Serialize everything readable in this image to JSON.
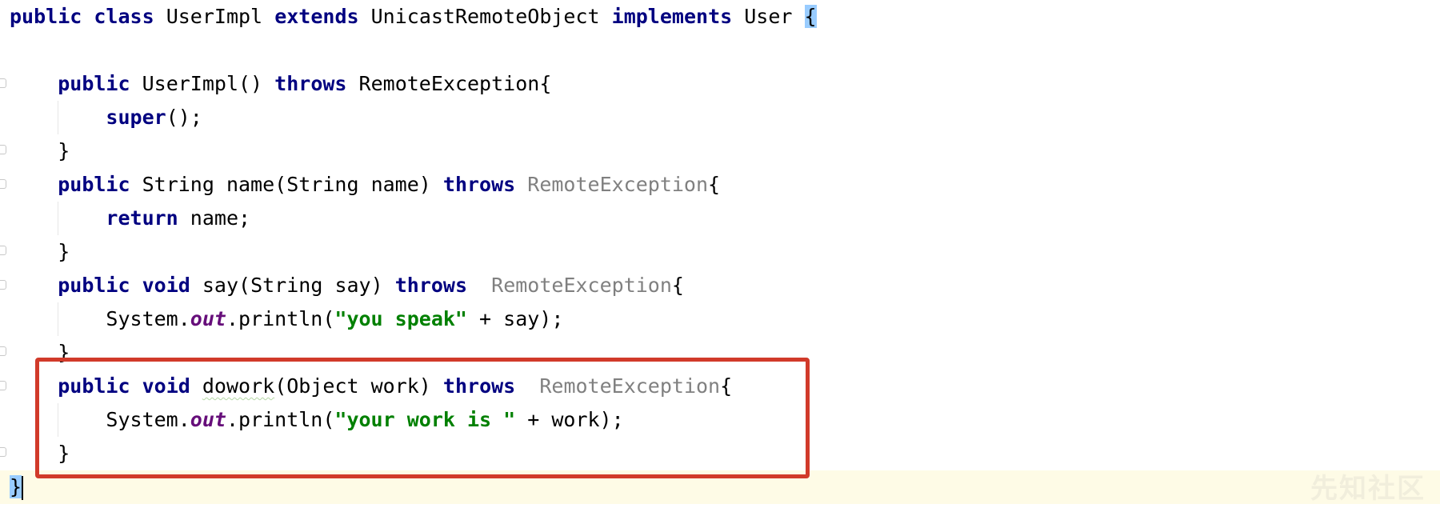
{
  "editor": {
    "lines": {
      "class_decl": {
        "kw1": "public",
        "kw2": "class",
        "name": "UserImpl",
        "kw3": "extends",
        "parent": "UnicastRemoteObject",
        "kw4": "implements",
        "iface": "User",
        "brace": "{"
      },
      "ctor_decl": {
        "kw1": "public",
        "name": "UserImpl()",
        "kw2": "throws",
        "exc": "RemoteException{"
      },
      "ctor_body": {
        "kw": "super",
        "rest": "();"
      },
      "close1": {
        "text": "}"
      },
      "name_decl": {
        "kw1": "public",
        "sig": "String name(String name)",
        "kw2": "throws",
        "exc": "RemoteException",
        "brace": "{"
      },
      "name_body": {
        "kw": "return",
        "rest": "name;"
      },
      "close2": {
        "text": "}"
      },
      "say_decl": {
        "kw1": "public",
        "kw2": "void",
        "sig": "say(String say)",
        "kw3": "throws",
        "exc": "RemoteException",
        "brace": "{"
      },
      "say_body": {
        "pre": "System.",
        "field": "out",
        "mid": ".println(",
        "str": "\"you speak\"",
        "post": " + say);"
      },
      "close3": {
        "text": "}"
      },
      "dowork_decl": {
        "kw1": "public",
        "kw2": "void",
        "method": "dowork",
        "sig": "(Object work)",
        "kw3": "throws",
        "exc": "RemoteException",
        "brace": "{"
      },
      "dowork_body": {
        "pre": "System.",
        "field": "out",
        "mid": ".println(",
        "str": "\"your work is \"",
        "post": " + work);"
      },
      "close4": {
        "text": "}"
      },
      "close_class": {
        "text": "}"
      }
    },
    "colors": {
      "keyword": "#000080",
      "string": "#008000",
      "static_field": "#660e7a",
      "unused_type": "#808080",
      "highlight_box": "#d13a2a",
      "brace_match": "#99ccff",
      "current_line": "#fefbe6"
    }
  },
  "watermark": {
    "text": "先知社区"
  }
}
